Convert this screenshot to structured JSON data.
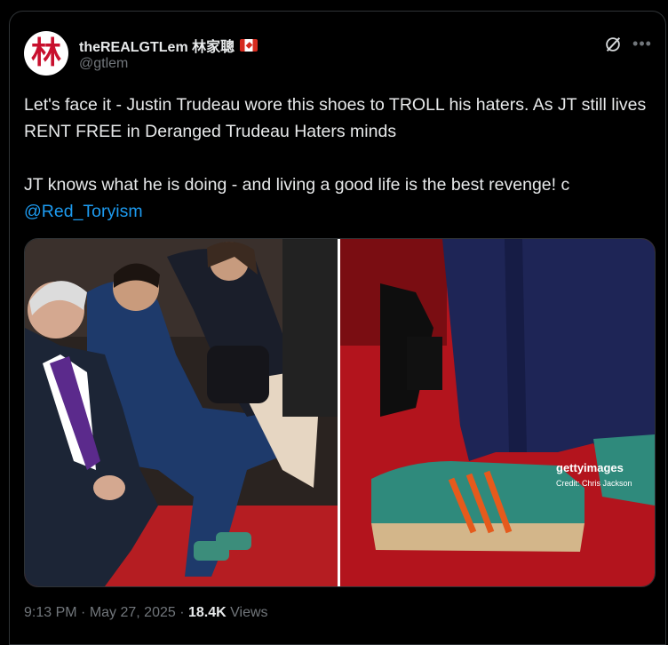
{
  "author": {
    "display_name": "theREALGTLem 林家聰",
    "handle": "@gtlem",
    "avatar_glyph": "林"
  },
  "post": {
    "paragraph1": "Let's face it - Justin Trudeau wore this shoes to TROLL his haters. As JT still lives RENT FREE in Deranged Trudeau Haters minds",
    "paragraph2": "JT knows what he is doing - and living a good life is the best revenge! c",
    "mention": "@Red_Toryism"
  },
  "media": {
    "watermark_logo": "gettyimages",
    "watermark_credit": "Credit: Chris Jackson"
  },
  "meta": {
    "time": "9:13 PM",
    "separator1": " · ",
    "date": "May 27, 2025",
    "separator2": " · ",
    "views_count": "18.4K",
    "views_label": " Views"
  },
  "icons": {
    "grok": "grok-icon",
    "more": "more-icon"
  },
  "colors": {
    "mention": "#1d9bf0",
    "muted": "#71767b",
    "flag_red": "#d52b1e"
  }
}
